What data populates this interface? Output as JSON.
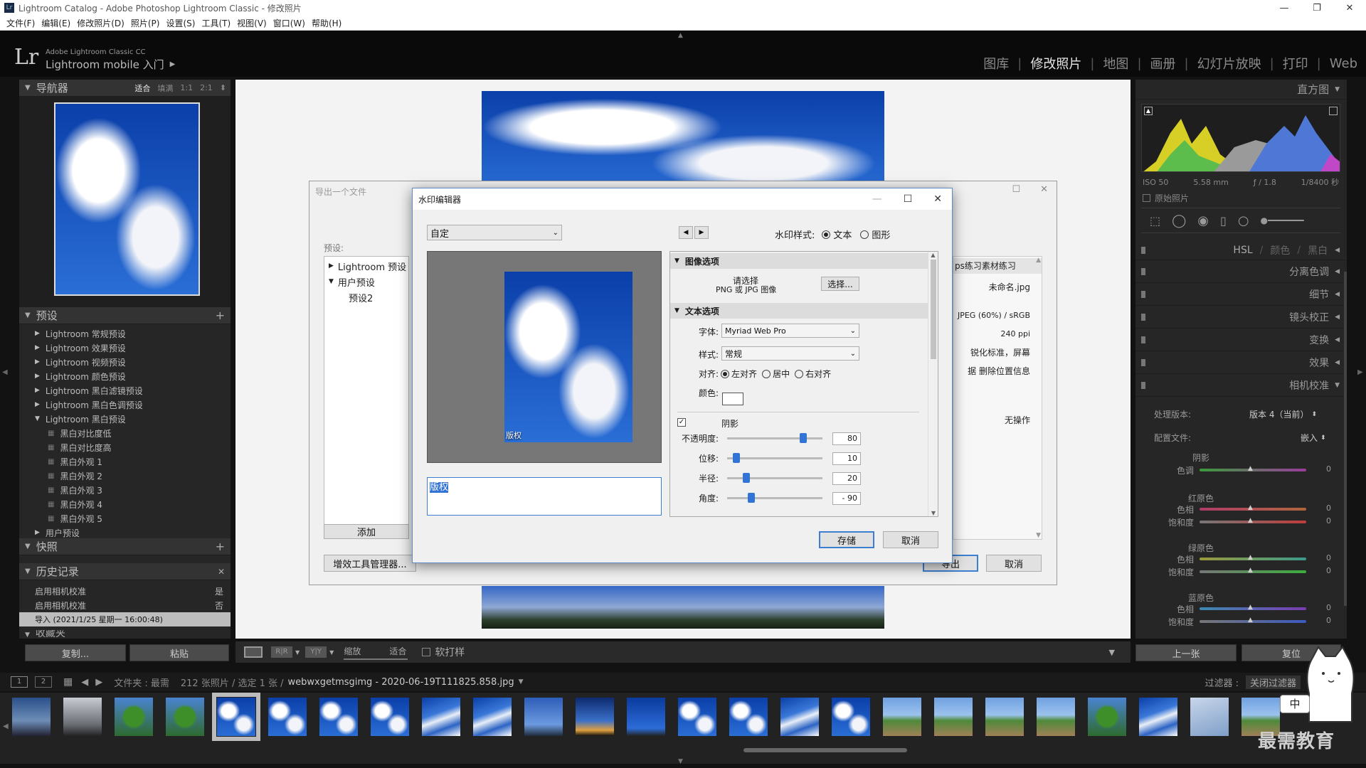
{
  "window": {
    "title": "Lightroom Catalog - Adobe Photoshop Lightroom Classic - 修改照片"
  },
  "menu": [
    "文件(F)",
    "编辑(E)",
    "修改照片(D)",
    "照片(P)",
    "设置(S)",
    "工具(T)",
    "视图(V)",
    "窗口(W)",
    "帮助(H)"
  ],
  "header": {
    "logo": "Lr",
    "product_small": "Adobe Lightroom Classic CC",
    "product_big": "Lightroom mobile 入门",
    "modules": [
      "图库",
      "修改照片",
      "地图",
      "画册",
      "幻灯片放映",
      "打印",
      "Web"
    ],
    "active_module": "修改照片"
  },
  "navigator": {
    "title": "导航器",
    "zoom_options": [
      "适合",
      "填满",
      "1:1",
      "2:1"
    ]
  },
  "presets": {
    "title": "预设",
    "items": [
      "Lightroom 常规预设",
      "Lightroom 效果预设",
      "Lightroom 视频预设",
      "Lightroom 颜色预设",
      "Lightroom 黑白滤镜预设",
      "Lightroom 黑白色调预设",
      "Lightroom 黑白预设"
    ],
    "bw_children": [
      "黑白对比度低",
      "黑白对比度高",
      "黑白外观 1",
      "黑白外观 2",
      "黑白外观 3",
      "黑白外观 4",
      "黑白外观 5"
    ],
    "user": "用户预设"
  },
  "snapshots": {
    "title": "快照"
  },
  "history": {
    "title": "历史记录",
    "rows": [
      {
        "label": "启用相机校准",
        "value": "是"
      },
      {
        "label": "启用相机校准",
        "value": "否"
      },
      {
        "label": "导入 (2021/1/25 星期一 16:00:48)",
        "value": ""
      }
    ]
  },
  "collections": {
    "title": "收藏夹"
  },
  "left_buttons": {
    "copy": "复制...",
    "paste": "粘贴"
  },
  "toolbar": {
    "zoom_label": "缩放",
    "zoom_value": "适合",
    "soft_proof": "软打样"
  },
  "export_dialog": {
    "title": "导出一个文件",
    "preset_label": "预设:",
    "tree": [
      "Lightroom 预设",
      "用户预设",
      "预设2"
    ],
    "add": "添加",
    "plugin_manager": "增效工具管理器...",
    "export": "导出",
    "cancel": "取消",
    "right_values": [
      "ps练习素材练习",
      "未命名.jpg",
      "JPEG (60%) / sRGB",
      "240 ppi",
      "锐化标准，屏幕",
      "据 删除位置信息",
      "无操作"
    ]
  },
  "watermark_dialog": {
    "title": "水印编辑器",
    "preset": "自定",
    "style_label": "水印样式:",
    "style_text": "文本",
    "style_graphic": "图形",
    "watermark_text": "版权",
    "image_options": {
      "title": "图像选项",
      "line1": "请选择",
      "line2": "PNG 或 JPG 图像",
      "choose": "选择..."
    },
    "text_options": {
      "title": "文本选项",
      "font_label": "字体:",
      "font": "Myriad Web Pro",
      "style_label": "样式:",
      "style": "常规",
      "align_label": "对齐:",
      "align": [
        "左对齐",
        "居中",
        "右对齐"
      ],
      "color_label": "颜色:"
    },
    "shadow": {
      "title": "阴影",
      "rows": [
        {
          "label": "不透明度:",
          "value": "80",
          "level": 0.8
        },
        {
          "label": "位移:",
          "value": "10",
          "level": 0.1
        },
        {
          "label": "半径:",
          "value": "20",
          "level": 0.2
        },
        {
          "label": "角度:",
          "value": "- 90",
          "level": 0.25
        }
      ]
    },
    "save": "存储",
    "cancel": "取消"
  },
  "histogram": {
    "title": "直方图",
    "info": [
      "ISO 50",
      "5.58 mm",
      "ƒ / 1.8",
      "1/8400 秒"
    ],
    "original": "原始照片"
  },
  "right_panels": {
    "hsl": [
      "HSL",
      "颜色",
      "黑白"
    ],
    "items": [
      "分离色调",
      "细节",
      "镜头校正",
      "变换",
      "效果",
      "相机校准"
    ]
  },
  "calibration": {
    "process_label": "处理版本:",
    "process_value": "版本 4（当前）",
    "profile_label": "配置文件:",
    "profile_value": "嵌入",
    "groups": [
      {
        "title": "阴影",
        "rows": [
          {
            "label": "色调",
            "value": "0"
          }
        ]
      },
      {
        "title": "红原色",
        "rows": [
          {
            "label": "色相",
            "value": "0"
          },
          {
            "label": "饱和度",
            "value": "0"
          }
        ]
      },
      {
        "title": "绿原色",
        "rows": [
          {
            "label": "色相",
            "value": "0"
          },
          {
            "label": "饱和度",
            "value": "0"
          }
        ]
      },
      {
        "title": "蓝原色",
        "rows": [
          {
            "label": "色相",
            "value": "0"
          },
          {
            "label": "饱和度",
            "value": "0"
          }
        ]
      }
    ]
  },
  "right_buttons": {
    "prev": "上一张",
    "reset": "复位"
  },
  "filmstrip_bar": {
    "page1": "1",
    "page2": "2",
    "folder": "文件夹 : 最需",
    "count": "212 张照片 / 选定 1 张 /",
    "filename": "webwxgetmsgimg - 2020-06-19T111825.858.jpg",
    "filter_label": "过滤器 :",
    "filter_value": "关闭过滤器"
  },
  "brand": {
    "text": "最需教育",
    "ime": "中"
  }
}
